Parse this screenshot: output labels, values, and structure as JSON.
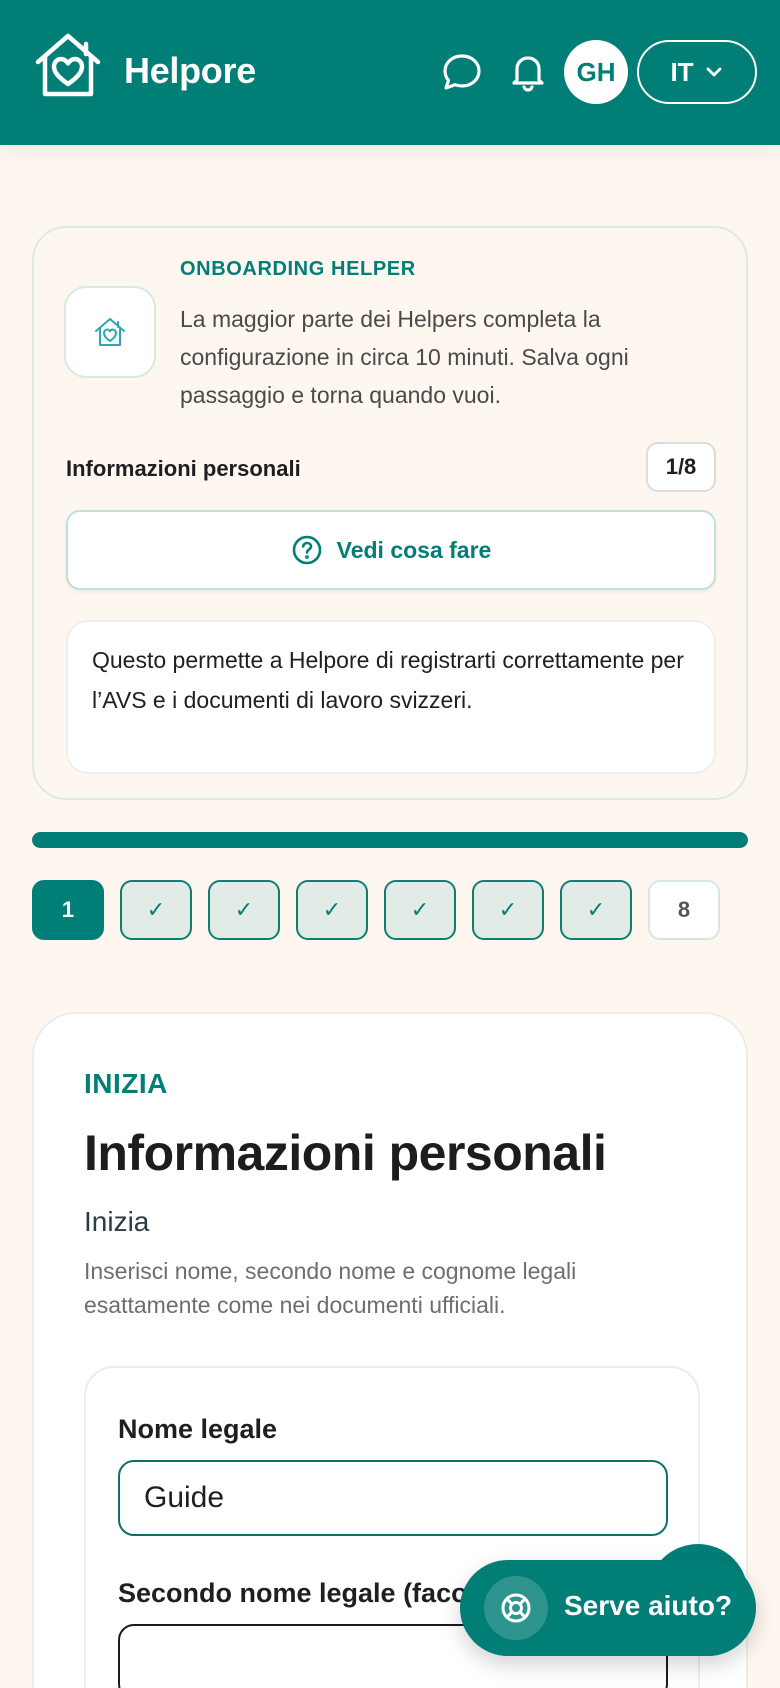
{
  "header": {
    "brand": "Helpore",
    "avatar_initials": "GH",
    "language": "IT",
    "brand_color": "#017e76"
  },
  "onboarding": {
    "eyebrow": "ONBOARDING HELPER",
    "description": "La maggior parte dei Helpers completa la configurazione in circa 10 minuti. Salva ogni passaggio e torna quando vuoi.",
    "step_label": "Informazioni personali",
    "step_count": "1/8",
    "help_button": "Vedi cosa fare",
    "note": "Questo permette a Helpore di registrarti correttamente per l’AVS e i documenti di lavoro svizzeri."
  },
  "progress": {
    "fraction": 1.0,
    "steps": [
      {
        "label": "1",
        "state": "current"
      },
      {
        "label": "✓",
        "state": "done"
      },
      {
        "label": "✓",
        "state": "done"
      },
      {
        "label": "✓",
        "state": "done"
      },
      {
        "label": "✓",
        "state": "done"
      },
      {
        "label": "✓",
        "state": "done"
      },
      {
        "label": "✓",
        "state": "done"
      },
      {
        "label": "8",
        "state": "todo"
      }
    ]
  },
  "form": {
    "eyebrow": "INIZIA",
    "title": "Informazioni personali",
    "subtitle": "Inizia",
    "description": "Inserisci nome, secondo nome e cognome legali esattamente come nei documenti ufficiali.",
    "fields": {
      "legal_name_label": "Nome legale",
      "legal_name_value": "Guide",
      "middle_name_label": "Secondo nome legale (facoltativo)",
      "middle_name_value": ""
    }
  },
  "help_fab": {
    "label": "Serve aiuto?"
  }
}
